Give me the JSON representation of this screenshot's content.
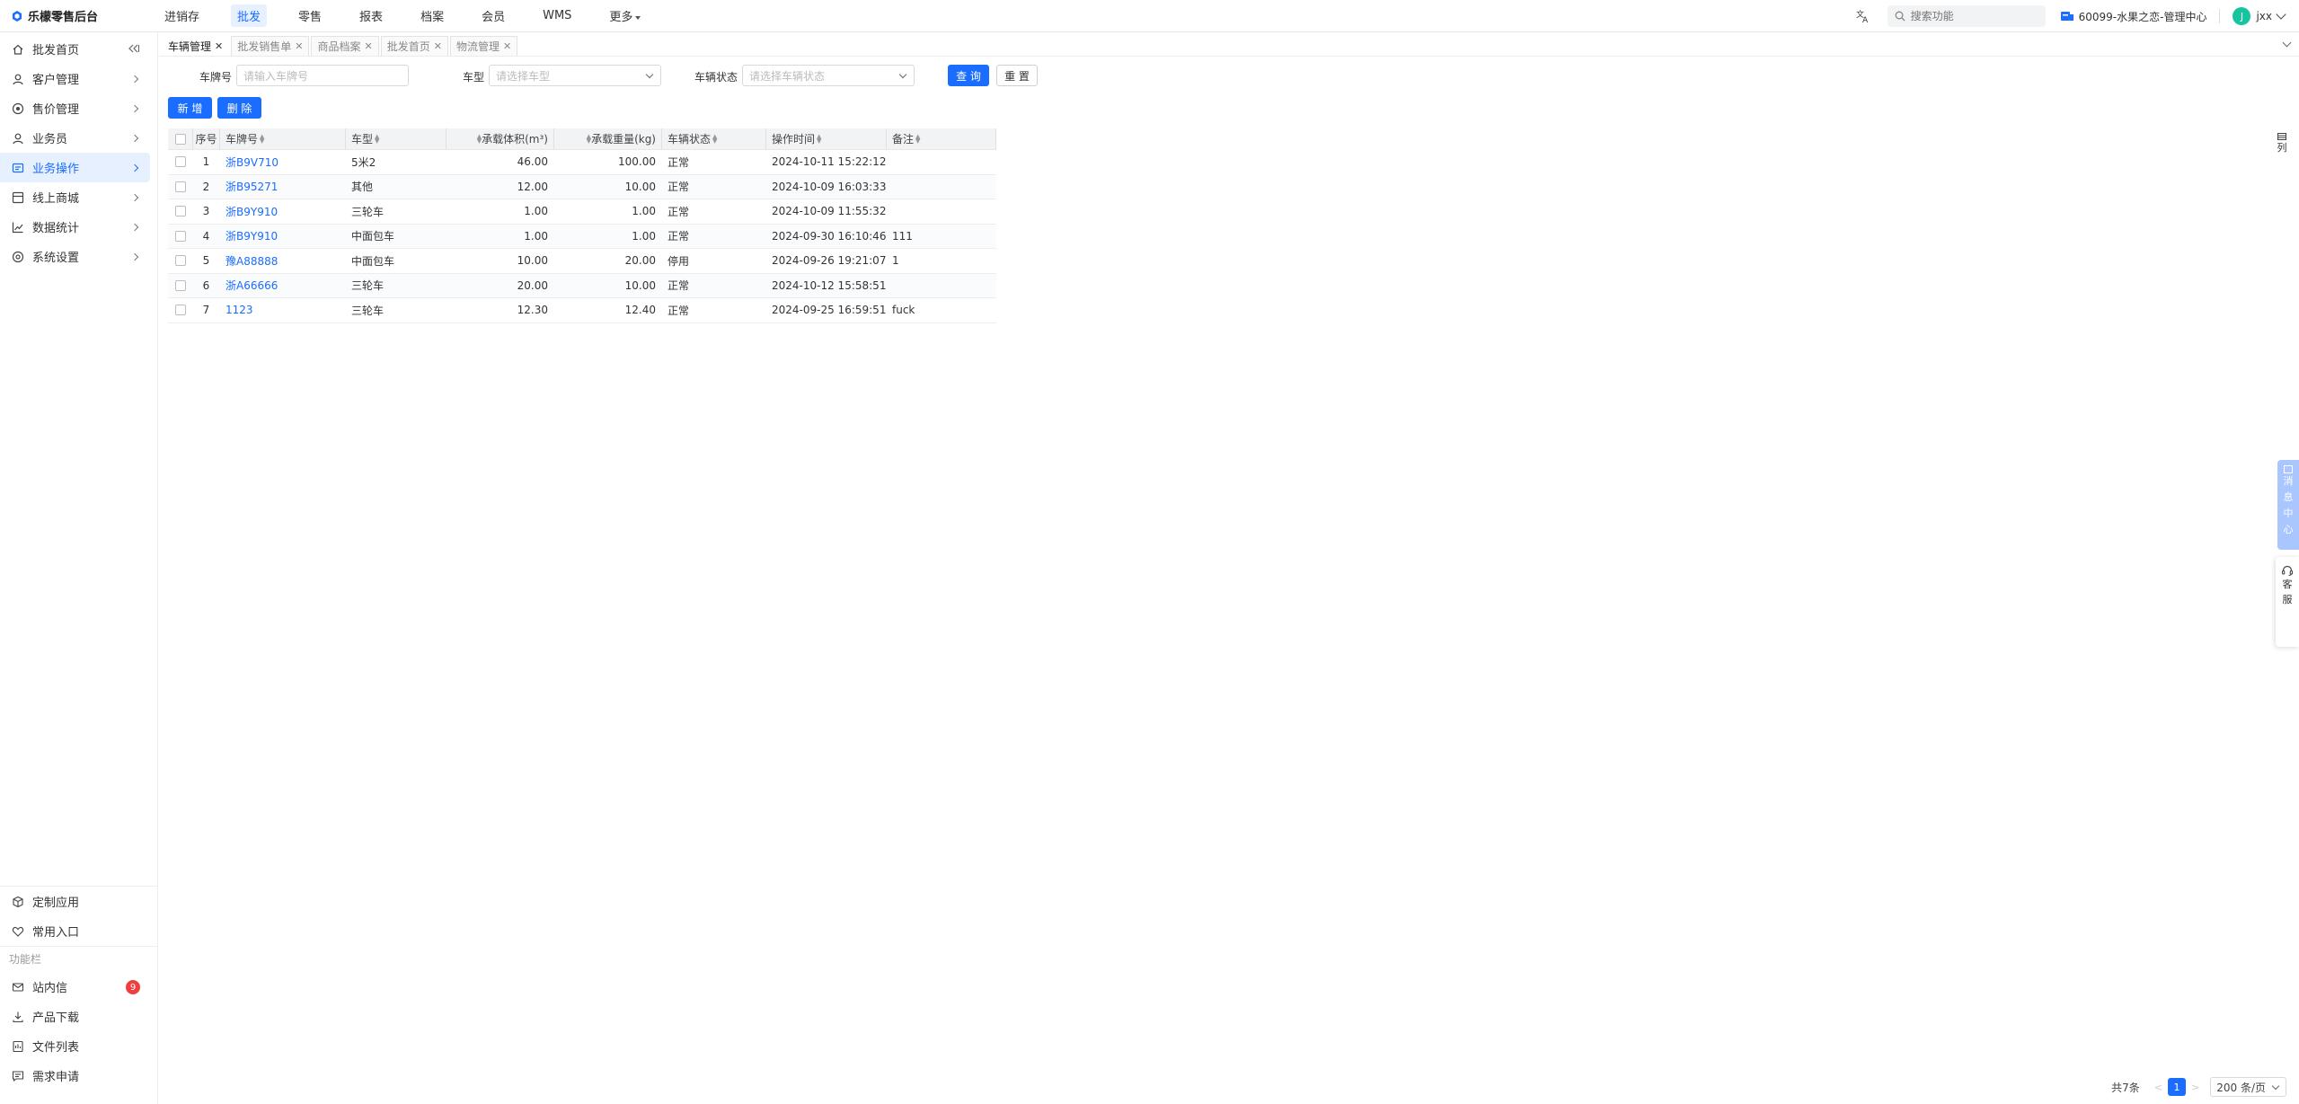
{
  "app": {
    "title": "乐檬零售后台"
  },
  "topnav": [
    {
      "label": "进销存",
      "active": false
    },
    {
      "label": "批发",
      "active": true
    },
    {
      "label": "零售",
      "active": false
    },
    {
      "label": "报表",
      "active": false
    },
    {
      "label": "档案",
      "active": false
    },
    {
      "label": "会员",
      "active": false
    },
    {
      "label": "WMS",
      "active": false
    },
    {
      "label": "更多",
      "active": false
    }
  ],
  "search": {
    "placeholder": "搜索功能"
  },
  "store": {
    "label": "60099-水果之恋-管理中心"
  },
  "user": {
    "initial": "J",
    "name": "jxx"
  },
  "sidebar": {
    "items": [
      {
        "label": "批发首页"
      },
      {
        "label": "客户管理"
      },
      {
        "label": "售价管理"
      },
      {
        "label": "业务员"
      },
      {
        "label": "业务操作"
      },
      {
        "label": "线上商城"
      },
      {
        "label": "数据统计"
      },
      {
        "label": "系统设置"
      }
    ],
    "bottom": {
      "custom_app": "定制应用",
      "favorites": "常用入口",
      "group_label": "功能栏",
      "inbox": "站内信",
      "inbox_badge": "9",
      "downloads": "产品下载",
      "files": "文件列表",
      "requests": "需求申请"
    }
  },
  "tabs": [
    {
      "label": "车辆管理",
      "active": true
    },
    {
      "label": "批发销售单",
      "active": false
    },
    {
      "label": "商品档案",
      "active": false
    },
    {
      "label": "批发首页",
      "active": false
    },
    {
      "label": "物流管理",
      "active": false
    }
  ],
  "filters": {
    "plate_label": "车牌号",
    "plate_placeholder": "请输入车牌号",
    "type_label": "车型",
    "type_placeholder": "请选择车型",
    "status_label": "车辆状态",
    "status_placeholder": "请选择车辆状态",
    "query_button": "查 询",
    "reset_button": "重 置"
  },
  "actions": {
    "add_button": "新 增",
    "delete_button": "删 除"
  },
  "table": {
    "columns": [
      "序号",
      "车牌号",
      "车型",
      "承载体积(m³)",
      "承载重量(kg)",
      "车辆状态",
      "操作时间",
      "备注"
    ],
    "rows": [
      {
        "no": "1",
        "plate": "浙B9V710",
        "type": "5米2",
        "volume": "46.00",
        "load": "100.00",
        "status": "正常",
        "time": "2024-10-11 15:22:12",
        "note": ""
      },
      {
        "no": "2",
        "plate": "浙B95271",
        "type": "其他",
        "volume": "12.00",
        "load": "10.00",
        "status": "正常",
        "time": "2024-10-09 16:03:33",
        "note": ""
      },
      {
        "no": "3",
        "plate": "浙B9Y910",
        "type": "三轮车",
        "volume": "1.00",
        "load": "1.00",
        "status": "正常",
        "time": "2024-10-09 11:55:32",
        "note": ""
      },
      {
        "no": "4",
        "plate": "浙B9Y910",
        "type": "中面包车",
        "volume": "1.00",
        "load": "1.00",
        "status": "正常",
        "time": "2024-09-30 16:10:46",
        "note": "111"
      },
      {
        "no": "5",
        "plate": "豫A88888",
        "type": "中面包车",
        "volume": "10.00",
        "load": "20.00",
        "status": "停用",
        "time": "2024-09-26 19:21:07",
        "note": "1"
      },
      {
        "no": "6",
        "plate": "浙A66666",
        "type": "三轮车",
        "volume": "20.00",
        "load": "10.00",
        "status": "正常",
        "time": "2024-10-12 15:58:51",
        "note": ""
      },
      {
        "no": "7",
        "plate": "1123",
        "type": "三轮车",
        "volume": "12.30",
        "load": "12.40",
        "status": "正常",
        "time": "2024-09-25 16:59:51",
        "note": "fuck"
      }
    ]
  },
  "right_dock": {
    "columns_label": "列",
    "message_center": [
      "消",
      "息",
      "中",
      "心"
    ],
    "service": [
      "客",
      "服"
    ]
  },
  "pagination": {
    "total": "共7条",
    "current": "1",
    "page_size": "200 条/页"
  },
  "colors": {
    "primary": "#1a6dff",
    "active_bg": "#e6f0ff",
    "avatar": "#16c4a0",
    "badge": "#f03e3e"
  }
}
